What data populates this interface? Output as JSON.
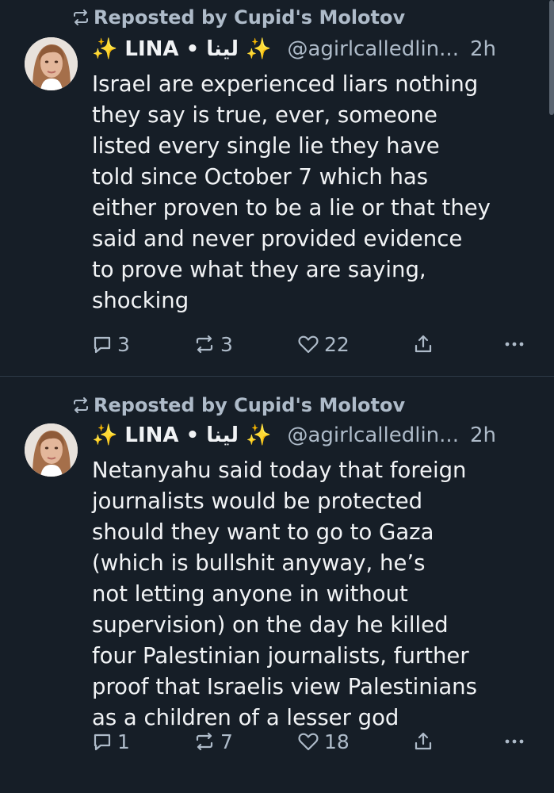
{
  "feed": {
    "posts": [
      {
        "repost_label": "Reposted by Cupid's Molotov",
        "display_name": "✨ LINA • لينا ✨",
        "handle": "@agirlcalledlin...",
        "time": "2h",
        "text": "Israel are experienced liars nothing\nthey say is true, ever, someone\nlisted every single lie they have\ntold since October 7 which has\neither proven to be a lie or that they\nsaid and never provided evidence\nto prove what they  are saying,\nshocking",
        "replies": "3",
        "reposts": "3",
        "likes": "22"
      },
      {
        "repost_label": "Reposted by Cupid's Molotov",
        "display_name": "✨ LINA • لينا ✨",
        "handle": "@agirlcalledlin...",
        "time": "2h",
        "text": "Netanyahu said today that foreign\njournalists would be protected\nshould they want to go to Gaza\n(which is bullshit anyway, he’s\nnot letting anyone in without\nsupervision) on the day he killed\nfour Palestinian journalists, further\nproof that Israelis view Palestinians\nas a children of a lesser god",
        "replies": "1",
        "reposts": "7",
        "likes": "18"
      }
    ]
  },
  "icons": {
    "repost_indicator": "repost-icon",
    "reply": "reply-icon",
    "repost": "repost-icon",
    "like": "heart-icon",
    "share": "share-icon",
    "more": "more-icon"
  },
  "colors": {
    "background": "#161e27",
    "text": "#f1f3f5",
    "muted": "#aebbc9",
    "divider": "#2e3a47"
  }
}
